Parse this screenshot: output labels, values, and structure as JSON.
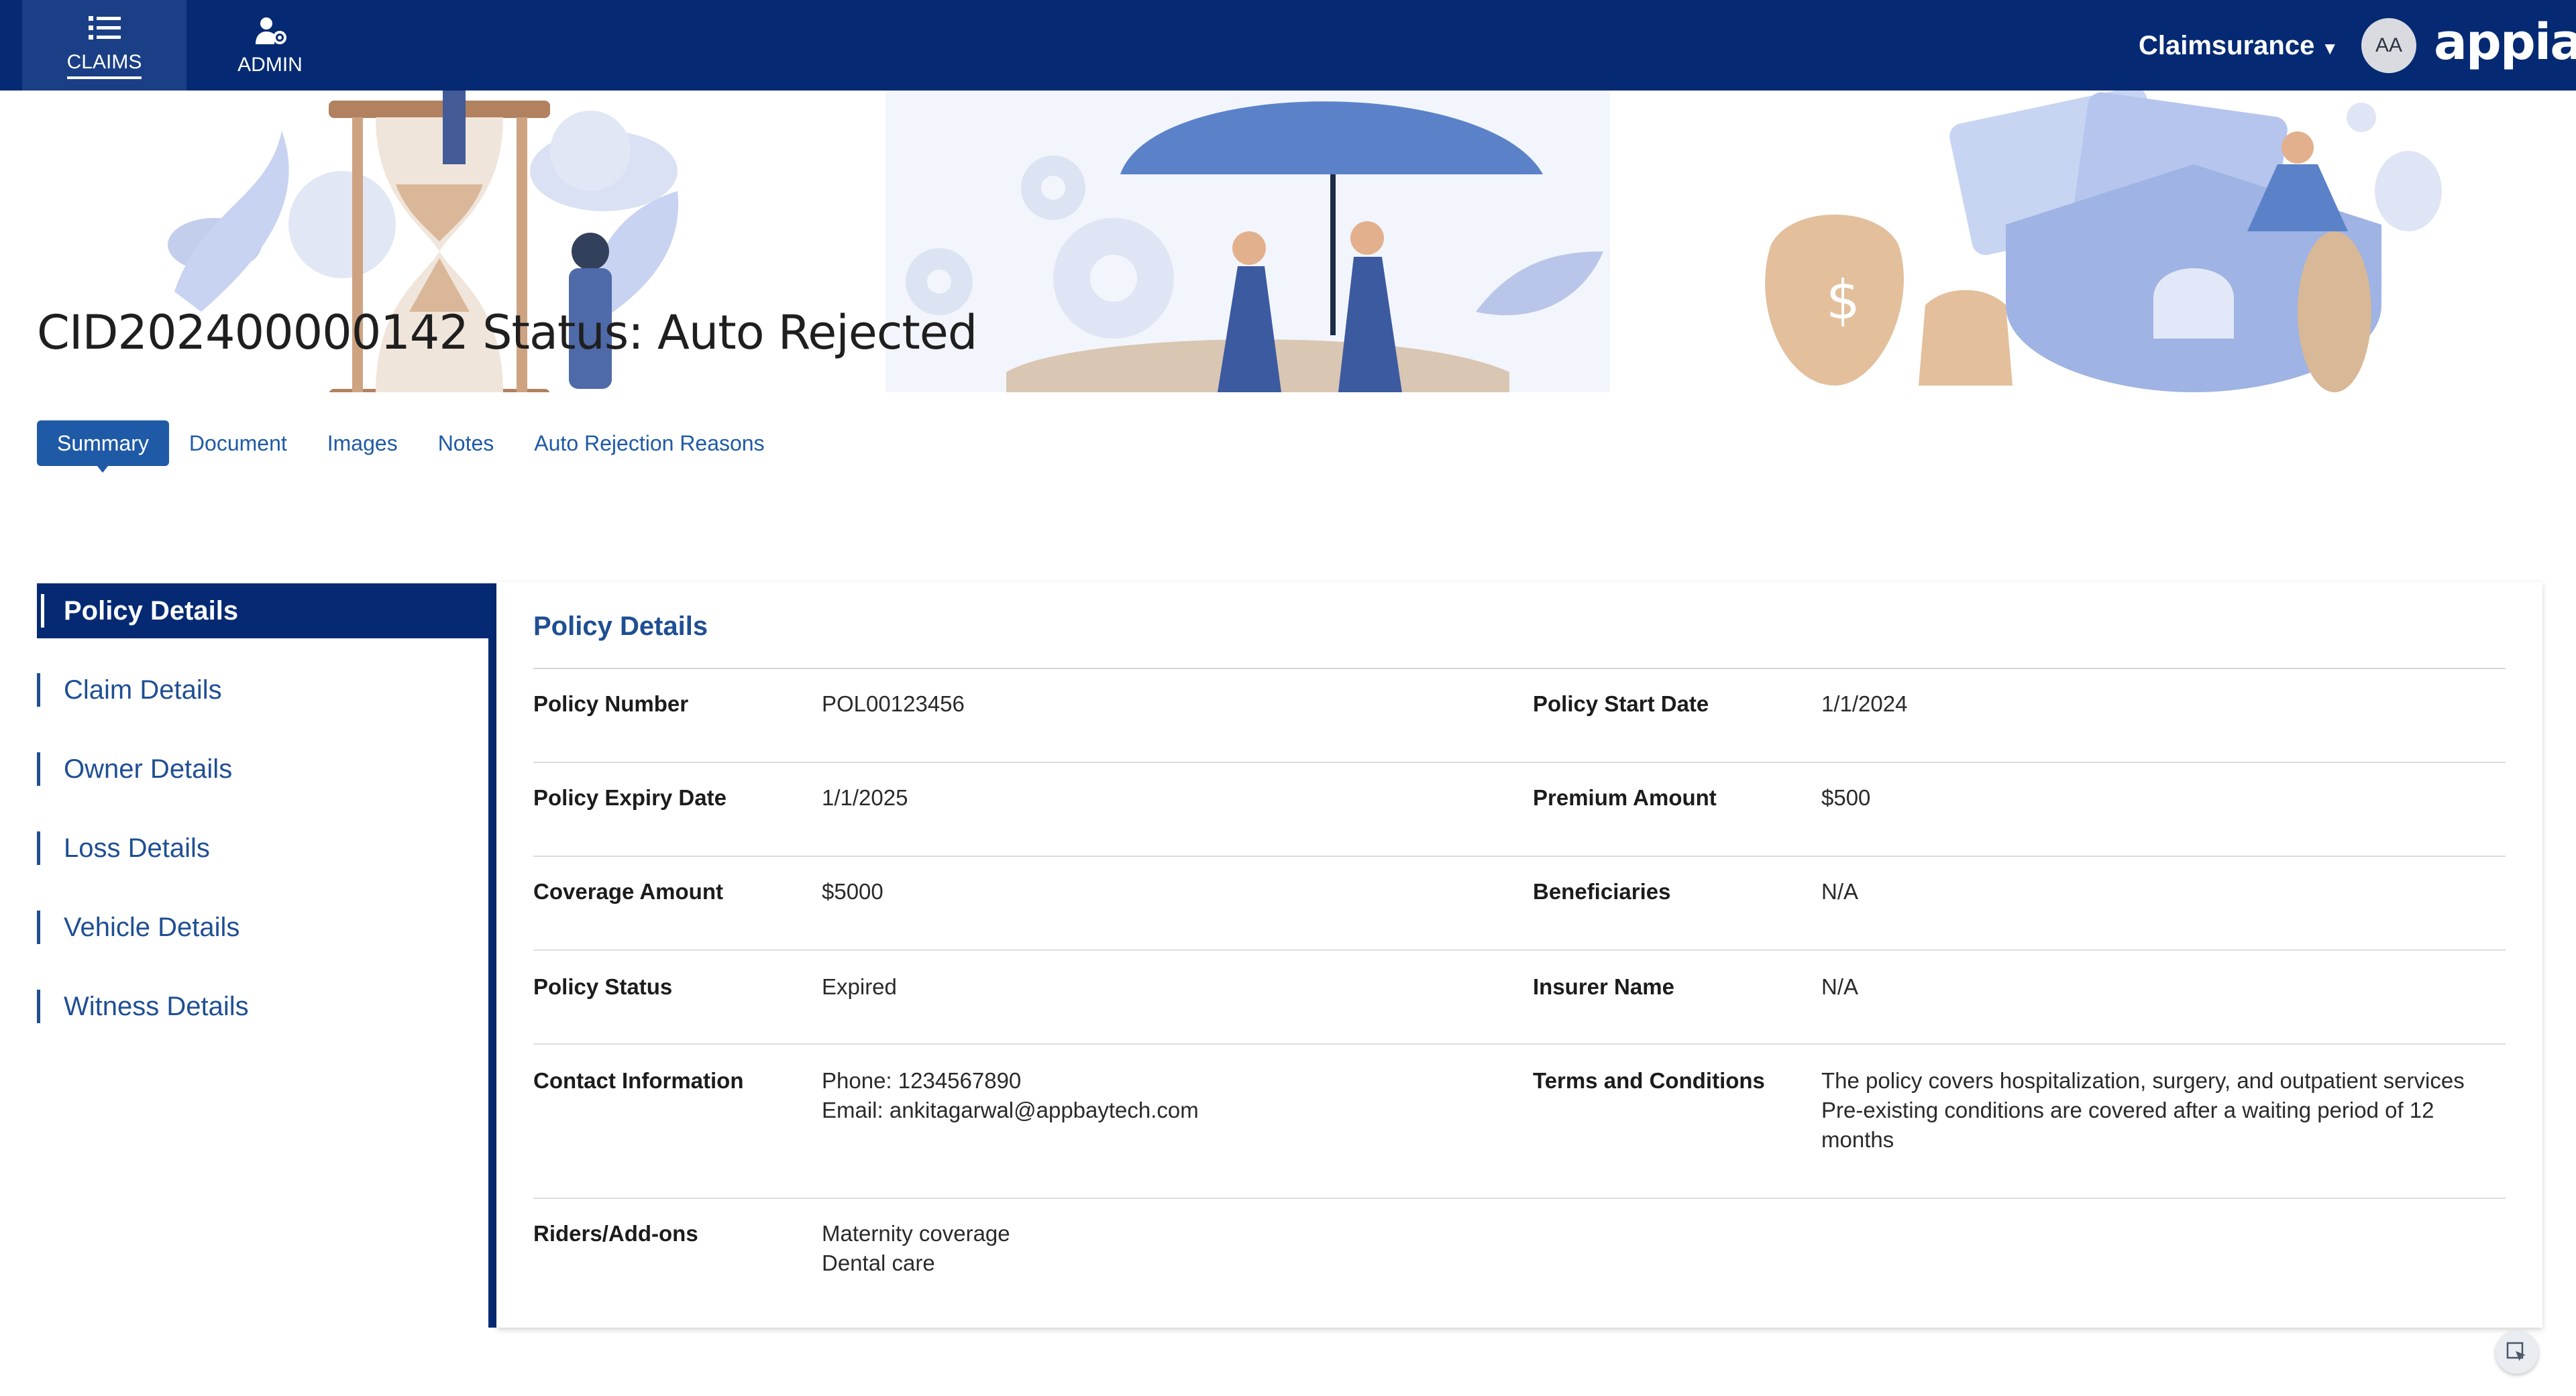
{
  "nav": {
    "tabs": [
      {
        "label": "CLAIMS",
        "icon": "list-icon"
      },
      {
        "label": "ADMIN",
        "icon": "user-gear-icon"
      }
    ],
    "app_name": "Claimsurance",
    "avatar_initials": "AA",
    "brand": "appian"
  },
  "page": {
    "title": "CID202400000142 Status: Auto Rejected"
  },
  "tabs": [
    "Summary",
    "Document",
    "Images",
    "Notes",
    "Auto Rejection Reasons"
  ],
  "sidebar": {
    "items": [
      "Policy Details",
      "Claim Details",
      "Owner Details",
      "Loss Details",
      "Vehicle Details",
      "Witness Details"
    ]
  },
  "panel": {
    "title": "Policy Details",
    "rows": [
      {
        "left": {
          "label": "Policy Number",
          "value": [
            "POL00123456"
          ]
        },
        "right": {
          "label": "Policy Start Date",
          "value": [
            "1/1/2024"
          ]
        }
      },
      {
        "left": {
          "label": "Policy Expiry Date",
          "value": [
            "1/1/2025"
          ]
        },
        "right": {
          "label": "Premium Amount",
          "value": [
            "$500"
          ]
        }
      },
      {
        "left": {
          "label": "Coverage Amount",
          "value": [
            "$5000"
          ]
        },
        "right": {
          "label": "Beneficiaries",
          "value": [
            "N/A"
          ]
        }
      },
      {
        "left": {
          "label": "Policy Status",
          "value": [
            "Expired"
          ]
        },
        "right": {
          "label": "Insurer Name",
          "value": [
            "N/A"
          ]
        }
      },
      {
        "left": {
          "label": "Contact Information",
          "value": [
            "Phone: 1234567890",
            "Email: ankitagarwal@appbaytech.com"
          ]
        },
        "right": {
          "label": "Terms and Conditions",
          "value": [
            "The policy covers hospitalization, surgery, and outpatient services",
            "Pre-existing conditions are covered after a waiting period of 12",
            "months"
          ]
        }
      },
      {
        "left": {
          "label": "Riders/Add-ons",
          "value": [
            "Maternity coverage",
            "Dental care"
          ]
        }
      }
    ]
  },
  "colors": {
    "nav_bg": "#052a73",
    "accent": "#1f5aa6",
    "link": "#1f4f93"
  }
}
